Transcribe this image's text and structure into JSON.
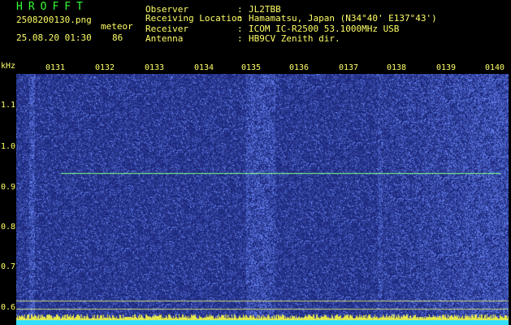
{
  "header": {
    "title": "HROFFT",
    "filename": "2508200130.png",
    "datetime": "25.08.20 01:30",
    "meteor_label": "meteor",
    "meteor_count": "86",
    "fields": [
      {
        "label": "Observer",
        "sep": ":",
        "value": "JL2TBB"
      },
      {
        "label": "Receiving Location",
        "sep": ":",
        "value": "Hamamatsu, Japan (N34°40' E137°43')"
      },
      {
        "label": "Receiver",
        "sep": ":",
        "value": "ICOM IC-R2500 53.1000MHz USB"
      },
      {
        "label": "Antenna",
        "sep": ":",
        "value": "HB9CV Zenith dir."
      }
    ]
  },
  "axis": {
    "y_unit": "kHz",
    "y_ticks": [
      "1.1",
      "1.0",
      "0.9",
      "0.8",
      "0.7",
      "0.6"
    ],
    "x_ticks": [
      "0131",
      "0132",
      "0133",
      "0134",
      "0135",
      "0136",
      "0137",
      "0138",
      "0139",
      "0140"
    ]
  },
  "colors": {
    "text_green": "#33ff33",
    "text_yellow": "#ffff66",
    "noise": "#1a2eb0",
    "signal": "#7fff7f"
  }
}
